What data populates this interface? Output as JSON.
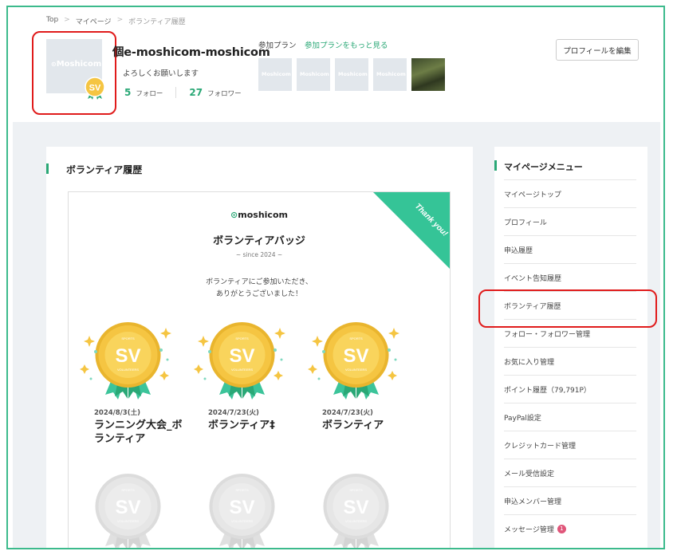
{
  "breadcrumb": [
    "Top",
    "マイページ",
    "ボランティア履歴"
  ],
  "breadcrumb_sep": ">",
  "profile": {
    "name": "個e-moshicom-moshicom",
    "greeting": "よろしくお願いします",
    "follow_count": "5",
    "follow_label": "フォロー",
    "follower_count": "27",
    "follower_label": "フォロワー",
    "avatar_logo": "Moshicom",
    "badge_text": "SV"
  },
  "plans": {
    "title": "参加プラン",
    "more_link": "参加プランをもっと見る",
    "thumb_logo": "Moshicom"
  },
  "edit_button": "プロフィールを編集",
  "main": {
    "section_title": "ボランティア履歴",
    "card": {
      "logo": "moshicom",
      "title": "ボランティアバッジ",
      "since": "~ since 2024 ~",
      "thanks": "ボランティアにご参加いただき、\nありがとうございました！",
      "ribbon": "Thank you!"
    },
    "badges": [
      {
        "date": "2024/8/3(土)",
        "name": "ランニング大会_ボランティア",
        "earned": true
      },
      {
        "date": "2024/7/23(火)",
        "name": "ボランティア‡",
        "earned": true
      },
      {
        "date": "2024/7/23(火)",
        "name": "ボランティア",
        "earned": true
      },
      {
        "earned": false
      },
      {
        "earned": false
      },
      {
        "earned": false
      }
    ],
    "badge_sv": "SV",
    "badge_top": "SPORTS",
    "badge_bottom": "VOLUNTEERS"
  },
  "sidebar": {
    "title": "マイページメニュー",
    "items": [
      {
        "label": "マイページトップ"
      },
      {
        "label": "プロフィール"
      },
      {
        "label": "申込履歴"
      },
      {
        "label": "イベント告知履歴"
      },
      {
        "label": "ボランティア履歴"
      },
      {
        "label": "フォロー・フォロワー管理"
      },
      {
        "label": "お気に入り管理"
      },
      {
        "label": "ポイント履歴（79,791P）"
      },
      {
        "label": "PayPal設定"
      },
      {
        "label": "クレジットカード管理"
      },
      {
        "label": "メール受信設定"
      },
      {
        "label": "申込メンバー管理"
      },
      {
        "label": "メッセージ管理",
        "badge": "1"
      }
    ]
  },
  "colors": {
    "accent": "#2aa876",
    "highlight": "#e01b1b",
    "gold": "#f5c542",
    "frame": "#3cba8c"
  }
}
